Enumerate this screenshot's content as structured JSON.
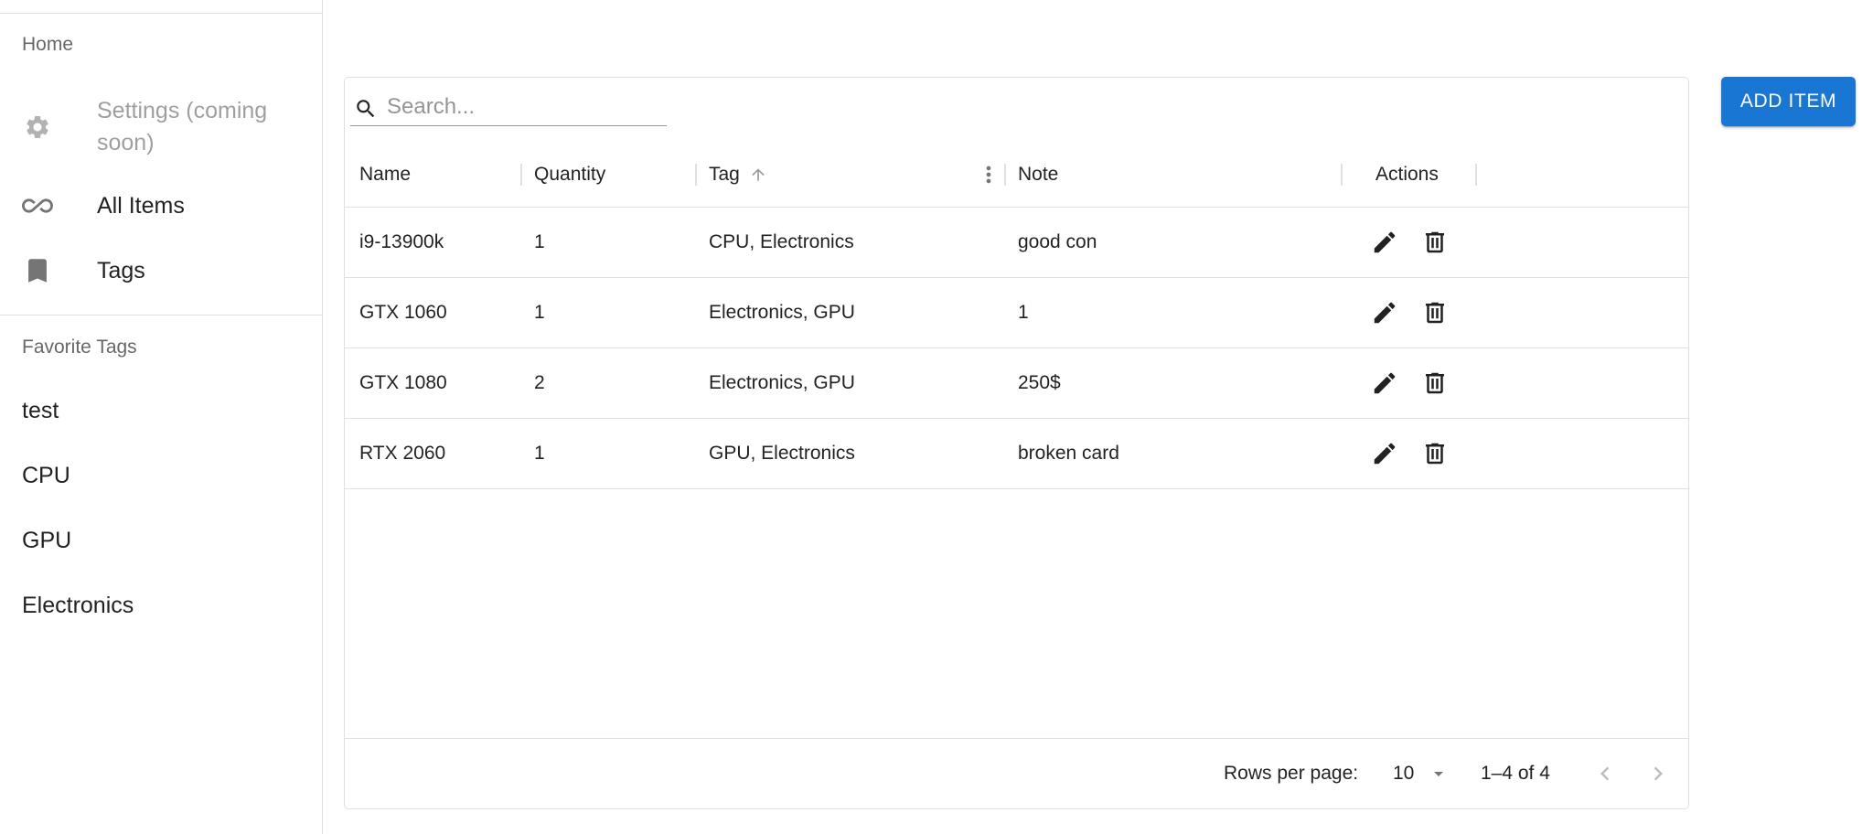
{
  "sidebar": {
    "home_label": "Home",
    "nav": [
      {
        "label": "Settings (coming soon)",
        "icon": "gear-icon",
        "disabled": true
      },
      {
        "label": "All Items",
        "icon": "infinity-icon"
      },
      {
        "label": "Tags",
        "icon": "bookmark-icon"
      }
    ],
    "favorites_header": "Favorite Tags",
    "favorites": [
      "test",
      "CPU",
      "GPU",
      "Electronics"
    ]
  },
  "toolbar": {
    "add_label": "ADD ITEM"
  },
  "grid": {
    "search_placeholder": "Search...",
    "columns": [
      "Name",
      "Quantity",
      "Tag",
      "Note",
      "Actions"
    ],
    "sort": {
      "column": "Tag",
      "direction": "asc"
    },
    "rows": [
      {
        "name": "i9-13900k",
        "quantity": "1",
        "tag": "CPU, Electronics",
        "note": "good con"
      },
      {
        "name": "GTX 1060",
        "quantity": "1",
        "tag": "Electronics, GPU",
        "note": "1"
      },
      {
        "name": "GTX 1080",
        "quantity": "2",
        "tag": "Electronics, GPU",
        "note": "250$"
      },
      {
        "name": "RTX 2060",
        "quantity": "1",
        "tag": "GPU, Electronics",
        "note": "broken card"
      }
    ],
    "footer": {
      "rows_per_page_label": "Rows per page:",
      "rows_per_page_value": "10",
      "range": "1–4 of 4"
    }
  },
  "colors": {
    "accent": "#1976d2",
    "divider": "#e0e0e0"
  }
}
